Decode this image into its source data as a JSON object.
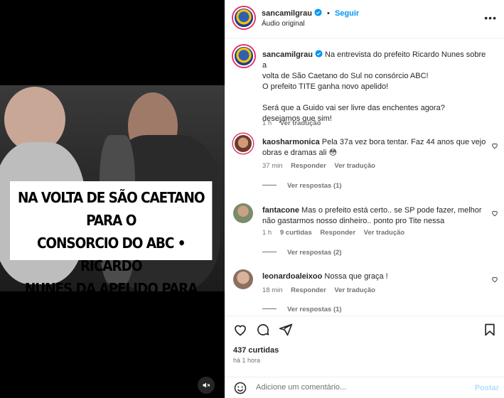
{
  "post": {
    "username": "sancamilgrau",
    "follow_label": "Seguir",
    "separator": "•",
    "audio": "Áudio original",
    "more_icon": "more-horizontal-icon",
    "caption_overlay": [
      "NA VOLTA DE SÃO CAETANO PARA O",
      "CONSORCIO DO ABC • RICARDO",
      "NUNES DA APELIDO PARA TITE"
    ],
    "description_lines": [
      "Na entrevista do prefeito Ricardo Nunes sobre a",
      "volta de São Caetano do Sul no consórcio ABC!",
      "O prefeito TITE ganha novo apelido!",
      "",
      "Será que a Guido vai ser livre das enchentes agora?",
      "desejamos que sim!"
    ],
    "description_time": "1 h",
    "description_translate": "Ver tradução",
    "likes": "437 curtidas",
    "posted_ago": "há 1 hora"
  },
  "comments": [
    {
      "username": "kaosharmonica",
      "text_line1": "Pela 37a vez bora tentar. Faz 44 anos que vejo",
      "text_line2": "obras e dramas ali",
      "emoji": "😳",
      "time": "37 min",
      "reply": "Responder",
      "translate": "Ver tradução",
      "replies": "Ver respostas (1)"
    },
    {
      "username": "fantacone",
      "text_line1": "Mas o prefeito está certo.. se SP pode fazer, melhor",
      "text_line2": "não gastarmos nosso dinheiro.. ponto pro Tite nessa",
      "time": "1 h",
      "likes": "9 curtidas",
      "reply": "Responder",
      "translate": "Ver tradução",
      "replies": "Ver respostas (2)"
    },
    {
      "username": "leonardoaleixoo",
      "text_line1": "Nossa que graça !",
      "time": "18 min",
      "reply": "Responder",
      "translate": "Ver tradução",
      "replies": "Ver respostas (1)"
    }
  ],
  "composer": {
    "placeholder": "Adicione um comentário...",
    "post_label": "Postar"
  },
  "colors": {
    "link_blue": "#0095f6",
    "post_disabled": "#b2dffc",
    "muted": "#737373"
  }
}
